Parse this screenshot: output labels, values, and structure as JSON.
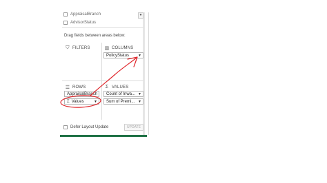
{
  "field_list": {
    "items": [
      {
        "label": "AppraisalBranch"
      },
      {
        "label": "AdvisorStatus"
      }
    ]
  },
  "hint_text": "Drag fields between areas below:",
  "areas": {
    "filters": {
      "title": "FILTERS",
      "icon": "filter-icon"
    },
    "columns": {
      "title": "COLUMNS",
      "icon": "columns-icon",
      "fields": [
        {
          "label": "PolicyStatus"
        }
      ]
    },
    "rows": {
      "title": "ROWS",
      "icon": "rows-icon",
      "fields": [
        {
          "label": "AppraisalBranch"
        },
        {
          "label": "Values",
          "prefix": "Σ"
        }
      ]
    },
    "values": {
      "title": "VALUES",
      "prefix": "Σ",
      "fields": [
        {
          "label": "Count of Inwa..."
        },
        {
          "label": "Sum of Premi..."
        }
      ]
    }
  },
  "footer": {
    "defer_label": "Defer Layout Update",
    "update_label": "UPDATE"
  },
  "colors": {
    "annotation": "#e0262b",
    "accent": "#1e7145"
  }
}
